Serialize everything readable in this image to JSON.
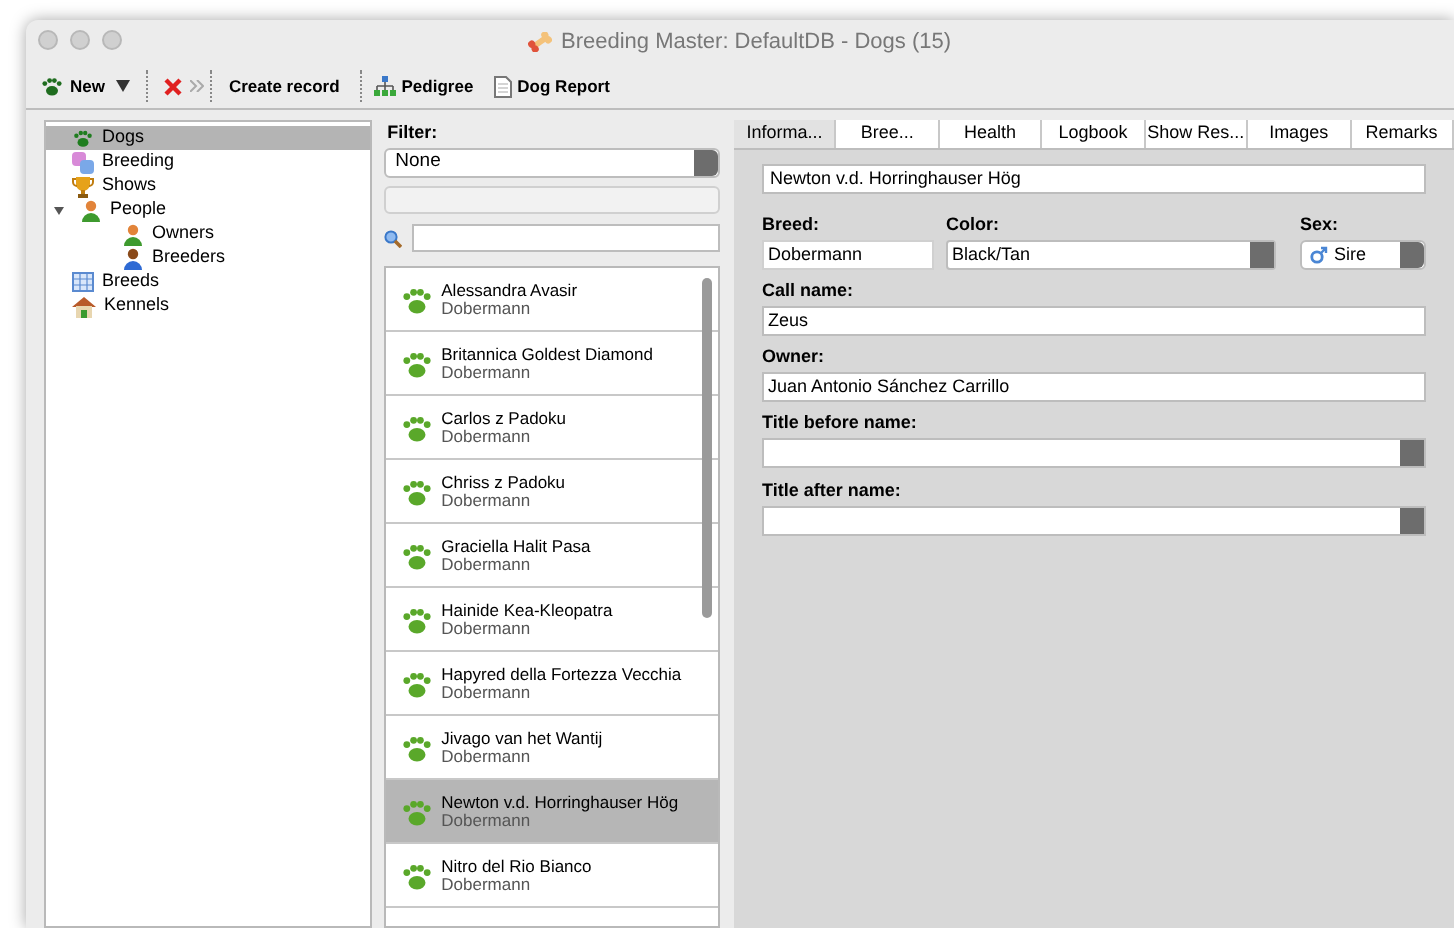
{
  "window": {
    "title": "Breeding Master: DefaultDB - Dogs (15)"
  },
  "toolbar": [
    {
      "kind": "new",
      "label": "New"
    },
    {
      "kind": "delete"
    },
    {
      "kind": "create",
      "label": "Create record"
    },
    {
      "kind": "pedigree",
      "label": "Pedigree"
    },
    {
      "kind": "report",
      "label": "Dog Report"
    }
  ],
  "sidebar": {
    "items": [
      {
        "label": "Dogs",
        "kind": "paw",
        "selected": true
      },
      {
        "label": "Breeding",
        "kind": "breeding",
        "selected": false
      },
      {
        "label": "Shows",
        "kind": "trophy",
        "selected": false
      },
      {
        "label": "People",
        "kind": "person",
        "selected": false,
        "expanded": true,
        "children": [
          {
            "label": "Owners",
            "kind": "person",
            "selected": false
          },
          {
            "label": "Breeders",
            "kind": "breeder",
            "selected": false
          }
        ]
      },
      {
        "label": "Breeds",
        "kind": "table",
        "selected": false
      },
      {
        "label": "Kennels",
        "kind": "house",
        "selected": false
      }
    ]
  },
  "filter": {
    "label": "Filter:",
    "value": "None"
  },
  "dogs": [
    {
      "name": "Alessandra Avasir",
      "breed": "Dobermann",
      "selected": false
    },
    {
      "name": "Britannica Goldest Diamond",
      "breed": "Dobermann",
      "selected": false
    },
    {
      "name": "Carlos z Padoku",
      "breed": "Dobermann",
      "selected": false
    },
    {
      "name": "Chriss z Padoku",
      "breed": "Dobermann",
      "selected": false
    },
    {
      "name": "Graciella Halit Pasa",
      "breed": "Dobermann",
      "selected": false
    },
    {
      "name": "Hainide Kea-Kleopatra",
      "breed": "Dobermann",
      "selected": false
    },
    {
      "name": "Hapyred della Fortezza Vecchia",
      "breed": "Dobermann",
      "selected": false
    },
    {
      "name": "Jivago van het Wantij",
      "breed": "Dobermann",
      "selected": false
    },
    {
      "name": "Newton v.d. Horringhauser Hög",
      "breed": "Dobermann",
      "selected": true
    },
    {
      "name": "Nitro del Rio Bianco",
      "breed": "Dobermann",
      "selected": false
    }
  ],
  "tabs": [
    {
      "label": "Informa...",
      "selected": true
    },
    {
      "label": "Bree...",
      "selected": false
    },
    {
      "label": "Health",
      "selected": false
    },
    {
      "label": "Logbook",
      "selected": false
    },
    {
      "label": "Show Res...",
      "selected": false
    },
    {
      "label": "Images",
      "selected": false
    },
    {
      "label": "Remarks",
      "selected": false
    }
  ],
  "form": {
    "name": "Newton v.d. Horringhauser Hög",
    "breed": {
      "label": "Breed:",
      "value": "Dobermann"
    },
    "color": {
      "label": "Color:",
      "value": "Black/Tan"
    },
    "sex": {
      "label": "Sex:",
      "value": "Sire"
    },
    "call_name": {
      "label": "Call name:",
      "value": "Zeus"
    },
    "owner": {
      "label": "Owner:",
      "value": "Juan Antonio Sánchez Carrillo"
    },
    "title_before": {
      "label": "Title before name:"
    },
    "title_after": {
      "label": "Title after name:"
    }
  }
}
